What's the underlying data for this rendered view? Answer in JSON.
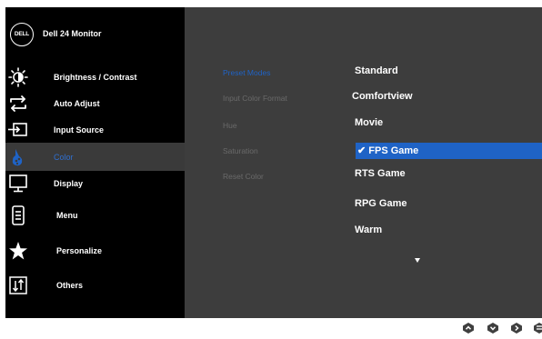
{
  "header": {
    "logo_text": "DELL",
    "model": "Dell 24 Monitor"
  },
  "sidebar": {
    "items": [
      {
        "label": "Brightness / Contrast",
        "icon": "brightness-icon"
      },
      {
        "label": "Auto Adjust",
        "icon": "auto-adjust-icon"
      },
      {
        "label": "Input Source",
        "icon": "input-source-icon"
      },
      {
        "label": "Color",
        "icon": "color-palette-icon",
        "active": true
      },
      {
        "label": "Display",
        "icon": "display-icon"
      },
      {
        "label": "Menu",
        "icon": "menu-icon"
      },
      {
        "label": "Personalize",
        "icon": "star-icon"
      },
      {
        "label": "Others",
        "icon": "others-icon"
      }
    ]
  },
  "color_menu": {
    "options": [
      "Preset Modes",
      "Input Color Format",
      "Hue",
      "Saturation",
      "Reset Color"
    ],
    "selected_option": "Preset Modes",
    "values": [
      "Standard",
      "Comfortview",
      "Movie",
      "✔ FPS Game",
      "RTS Game",
      "RPG Game",
      "Warm"
    ],
    "selected_value": "FPS Game"
  },
  "buttons": [
    {
      "icon": "up-icon"
    },
    {
      "icon": "down-icon"
    },
    {
      "icon": "right-icon"
    },
    {
      "icon": "back-icon"
    }
  ],
  "colors": {
    "accent": "#1f63c6",
    "sidebar_bg": "#000000",
    "content_bg": "#3d3d3d"
  }
}
